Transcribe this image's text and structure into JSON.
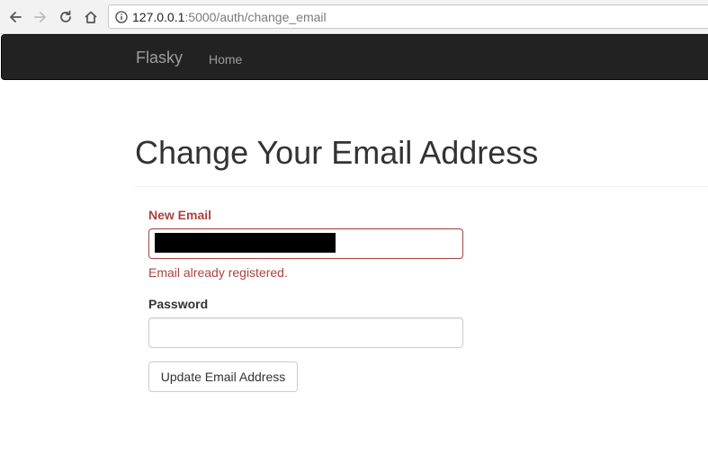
{
  "browser": {
    "url_host": "127.0.0.1",
    "url_rest": ":5000/auth/change_email"
  },
  "navbar": {
    "brand": "Flasky",
    "links": [
      {
        "label": "Home"
      }
    ]
  },
  "page": {
    "title": "Change Your Email Address"
  },
  "form": {
    "email": {
      "label": "New Email",
      "value": "",
      "error": "Email already registered."
    },
    "password": {
      "label": "Password",
      "value": ""
    },
    "submit_label": "Update Email Address"
  },
  "colors": {
    "navbar_bg": "#222222",
    "navbar_text": "#9d9d9d",
    "error": "#a94442",
    "heading": "#333333"
  }
}
